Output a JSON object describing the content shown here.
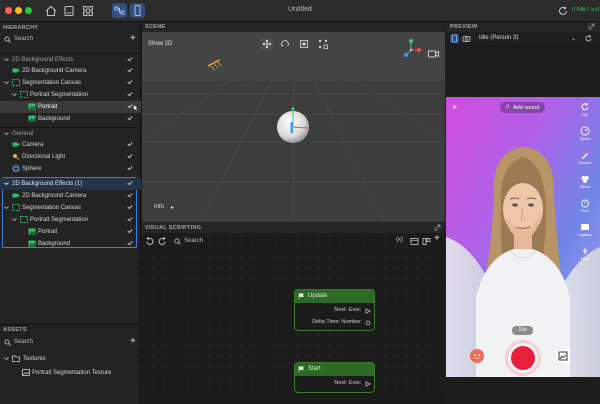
{
  "window": {
    "title": "Untitled",
    "stats": "0 MB / 5.0"
  },
  "hierarchy": {
    "label": "HIERARCHY",
    "search_placeholder": "Search",
    "groups": [
      {
        "title": "2D Background Effects",
        "items": [
          {
            "label": "2D Background Camera"
          },
          {
            "label": "Segmentation Canvas"
          },
          {
            "label": "Portrait Segmentation"
          },
          {
            "label": "Portrait"
          },
          {
            "label": "Background"
          }
        ]
      },
      {
        "title": "General",
        "items": [
          {
            "label": "Camera"
          },
          {
            "label": "Directional Light"
          },
          {
            "label": "Sphere"
          }
        ]
      },
      {
        "title": "2D Background Effects (1)",
        "items": [
          {
            "label": "2D Background Camera"
          },
          {
            "label": "Segmentation Canvas"
          },
          {
            "label": "Portrait Segmentation"
          },
          {
            "label": "Portrait"
          },
          {
            "label": "Background"
          }
        ]
      }
    ]
  },
  "assets": {
    "label": "ASSETS",
    "search_placeholder": "Search",
    "folder": "Textures",
    "item": "Portrait Segmentation Texture"
  },
  "scene": {
    "label": "SCENE",
    "mode": "Show 2D",
    "info": "Info"
  },
  "preview": {
    "label": "PREVIEW",
    "selector": "Idle (Person 3)",
    "add_sound": "Add sound",
    "side_icons": [
      "Flip",
      "Speed",
      "Retouch",
      "Effects",
      "Timer",
      "Captions",
      "Flash"
    ],
    "record_duration": "15s"
  },
  "visual_scripting": {
    "label": "VISUAL SCRIPTING",
    "search_placeholder": "Search",
    "nodes": [
      {
        "title": "Update",
        "outputs": [
          "Next: Exec",
          "Delta Time: Number"
        ]
      },
      {
        "title": "Start",
        "outputs": [
          "Next: Exec"
        ]
      }
    ]
  },
  "colors": {
    "accent_blue": "#3b7fd6",
    "node_green": "#2c6b23",
    "status_green": "#39c75a",
    "record_red": "#e8213b"
  }
}
